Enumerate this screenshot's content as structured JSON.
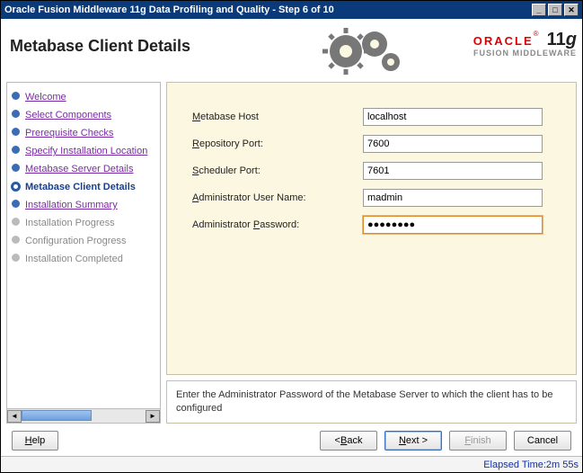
{
  "window_title": "Oracle Fusion Middleware 11g Data Profiling and Quality - Step 6 of 10",
  "page_title": "Metabase Client Details",
  "branding": {
    "vendor": "ORACLE",
    "reg": "®",
    "product_line": "FUSION MIDDLEWARE",
    "version_num": "11",
    "version_suffix": "g"
  },
  "steps": [
    {
      "label": "Welcome",
      "state": "done",
      "link": true
    },
    {
      "label": "Select Components",
      "state": "done",
      "link": true
    },
    {
      "label": "Prerequisite Checks",
      "state": "done",
      "link": true
    },
    {
      "label": "Specify Installation Location",
      "state": "done",
      "link": true
    },
    {
      "label": "Metabase Server Details",
      "state": "done",
      "link": true
    },
    {
      "label": "Metabase Client Details",
      "state": "current",
      "link": false
    },
    {
      "label": "Installation Summary",
      "state": "done",
      "link": true
    },
    {
      "label": "Installation Progress",
      "state": "future",
      "link": false
    },
    {
      "label": "Configuration Progress",
      "state": "future",
      "link": false
    },
    {
      "label": "Installation Completed",
      "state": "future",
      "link": false
    }
  ],
  "form": {
    "metabase_host": {
      "label_pre": "M",
      "label_rest": "etabase Host",
      "value": "localhost"
    },
    "repository_port": {
      "label_pre": "R",
      "label_rest": "epository Port:",
      "value": "7600"
    },
    "scheduler_port": {
      "label_pre": "S",
      "label_rest": "cheduler Port:",
      "value": "7601"
    },
    "admin_user": {
      "label_pre": "A",
      "label_rest": "dministrator User Name:",
      "value": "madmin"
    },
    "admin_password": {
      "label_plain": "Administrator ",
      "label_pre": "P",
      "label_rest": "assword:",
      "value": "●●●●●●●●"
    }
  },
  "hint": "Enter the Administrator Password of the Metabase Server to which the client has to be configured",
  "buttons": {
    "help": "elp",
    "help_u": "H",
    "back": "ack",
    "back_u": "B",
    "back_prefix": "< ",
    "next": "ext >",
    "next_u": "N",
    "finish": "inish",
    "finish_u": "F",
    "cancel": "Cancel"
  },
  "status": {
    "label": "Elapsed Time: ",
    "value": "2m 55s"
  }
}
